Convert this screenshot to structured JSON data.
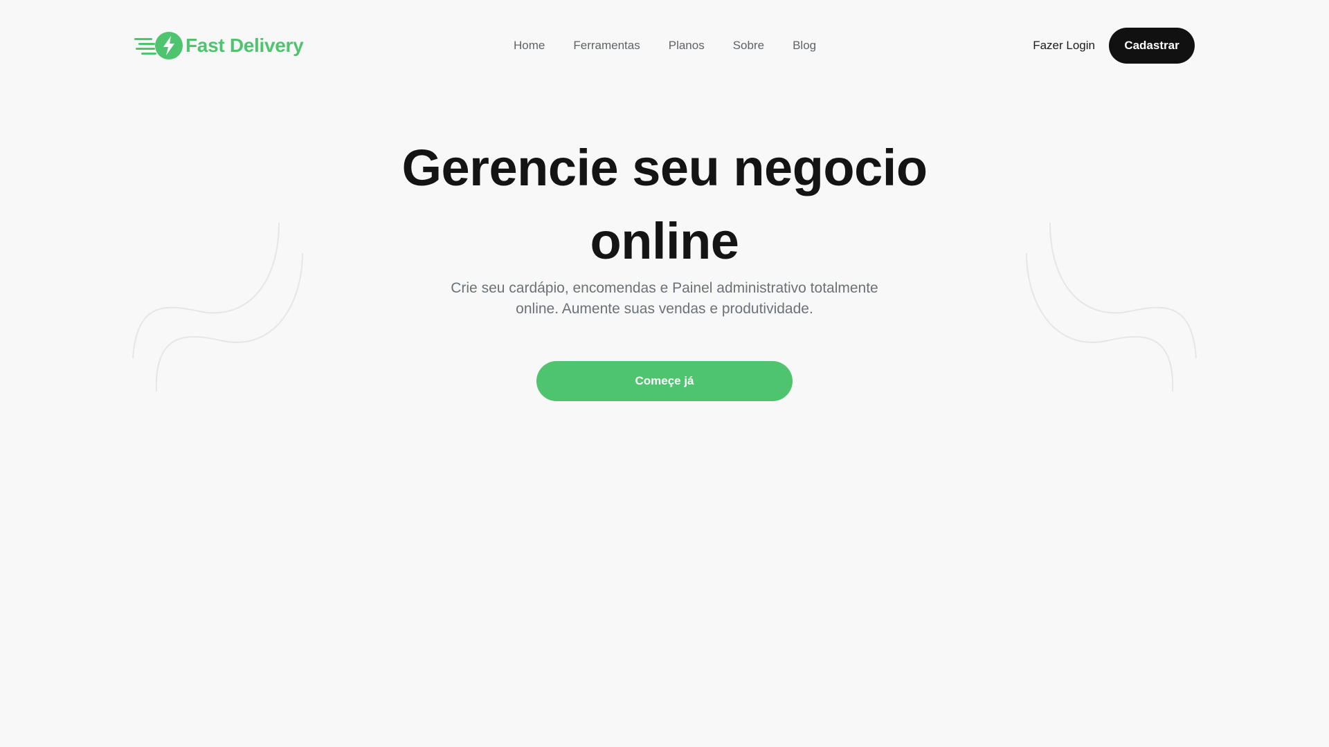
{
  "brand": {
    "name": "Fast Delivery",
    "logo_icon": "lightning-bolt-speed-icon",
    "accent_color": "#4fc46f"
  },
  "nav": {
    "items": [
      {
        "label": "Home"
      },
      {
        "label": "Ferramentas"
      },
      {
        "label": "Planos"
      },
      {
        "label": "Sobre"
      },
      {
        "label": "Blog"
      }
    ]
  },
  "header_actions": {
    "login_label": "Fazer Login",
    "signup_label": "Cadastrar",
    "signup_color": "#111111"
  },
  "hero": {
    "title": "Gerencie seu negocio online",
    "subtitle": "Crie seu cardápio, encomendas e Painel administrativo totalmente online. Aumente suas vendas e produtividade.",
    "cta_label": "Começe já"
  }
}
